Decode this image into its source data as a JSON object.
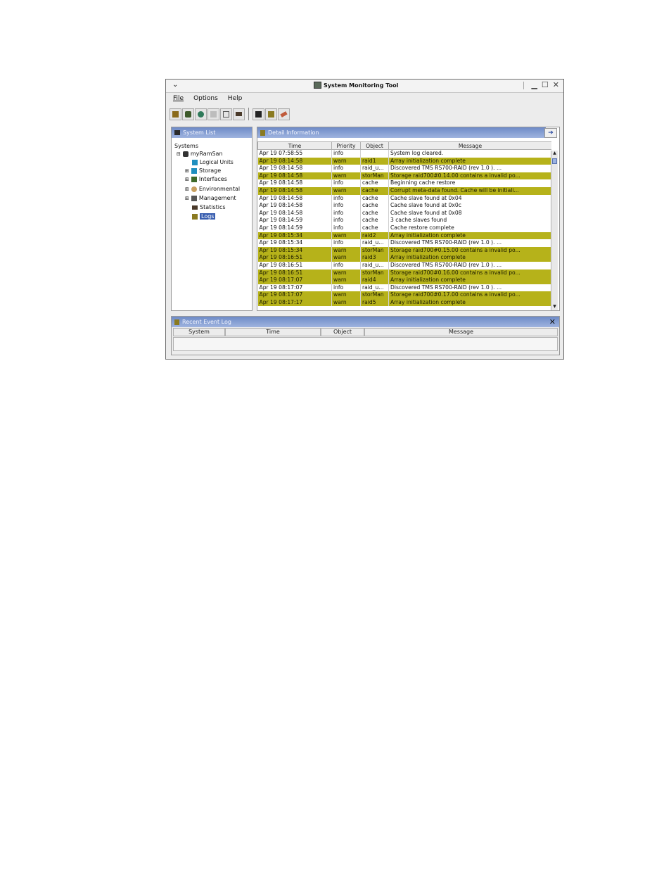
{
  "window": {
    "title": "System Monitoring Tool"
  },
  "menu": [
    "File",
    "Options",
    "Help"
  ],
  "toolbar_icons": [
    "open-system-icon",
    "add-system-icon",
    "globe-icon",
    "grid-icon",
    "collapse-icon",
    "display-icon",
    "save-icon",
    "notes-icon",
    "eraser-icon"
  ],
  "system_list": {
    "header": "System List",
    "root": "Systems",
    "system": "myRamSan",
    "items": [
      "Logical Units",
      "Storage",
      "Interfaces",
      "Environmental",
      "Management",
      "Statistics",
      "Logs"
    ]
  },
  "detail": {
    "header": "Detail Information",
    "columns": [
      "Time",
      "Priority",
      "Object",
      "Message"
    ],
    "rows": [
      {
        "time": "Apr 19 07:58:55",
        "priority": "info",
        "object": "",
        "message": "System log cleared."
      },
      {
        "time": "Apr 19 08:14:58",
        "priority": "warn",
        "object": "raid1",
        "message": "Array initialization complete"
      },
      {
        "time": "Apr 19 08:14:58",
        "priority": "info",
        "object": "raid_u...",
        "message": "Discovered TMS     RS700-RAID      (rev 1.0 ).  ..."
      },
      {
        "time": "Apr 19 08:14:58",
        "priority": "warn",
        "object": "storMan",
        "message": "Storage raid700#0.14.00 contains a invalid po..."
      },
      {
        "time": "Apr 19 08:14:58",
        "priority": "info",
        "object": "cache",
        "message": "Beginning cache restore"
      },
      {
        "time": "Apr 19 08:14:58",
        "priority": "warn",
        "object": "cache",
        "message": "Corrupt meta-data found.  Cache will be initiali..."
      },
      {
        "time": "Apr 19 08:14:58",
        "priority": "info",
        "object": "cache",
        "message": "Cache slave found at 0x04"
      },
      {
        "time": "Apr 19 08:14:58",
        "priority": "info",
        "object": "cache",
        "message": "Cache slave found at 0x0c"
      },
      {
        "time": "Apr 19 08:14:58",
        "priority": "info",
        "object": "cache",
        "message": "Cache slave found at 0x08"
      },
      {
        "time": "Apr 19 08:14:59",
        "priority": "info",
        "object": "cache",
        "message": "3 cache slaves found"
      },
      {
        "time": "Apr 19 08:14:59",
        "priority": "info",
        "object": "cache",
        "message": "Cache restore complete"
      },
      {
        "time": "Apr 19 08:15:34",
        "priority": "warn",
        "object": "raid2",
        "message": "Array initialization complete"
      },
      {
        "time": "Apr 19 08:15:34",
        "priority": "info",
        "object": "raid_u...",
        "message": "Discovered TMS     RS700-RAID      (rev 1.0 ).  ..."
      },
      {
        "time": "Apr 19 08:15:34",
        "priority": "warn",
        "object": "storMan",
        "message": "Storage raid700#0.15.00 contains a invalid po..."
      },
      {
        "time": "Apr 19 08:16:51",
        "priority": "warn",
        "object": "raid3",
        "message": "Array initialization complete"
      },
      {
        "time": "Apr 19 08:16:51",
        "priority": "info",
        "object": "raid_u...",
        "message": "Discovered TMS     RS700-RAID      (rev 1.0 ).  ..."
      },
      {
        "time": "Apr 19 08:16:51",
        "priority": "warn",
        "object": "storMan",
        "message": "Storage raid700#0.16.00 contains a invalid po..."
      },
      {
        "time": "Apr 19 08:17:07",
        "priority": "warn",
        "object": "raid4",
        "message": "Array initialization complete"
      },
      {
        "time": "Apr 19 08:17:07",
        "priority": "info",
        "object": "raid_u...",
        "message": "Discovered TMS     RS700-RAID      (rev 1.0 ).  ..."
      },
      {
        "time": "Apr 19 08:17:07",
        "priority": "warn",
        "object": "storMan",
        "message": "Storage raid700#0.17.00 contains a invalid po..."
      },
      {
        "time": "Apr 19 08:17:17",
        "priority": "warn",
        "object": "raid5",
        "message": "Array initialization complete"
      }
    ]
  },
  "recent": {
    "header": "Recent Event Log",
    "columns": [
      "System",
      "Time",
      "Object",
      "Message"
    ]
  },
  "colors": {
    "warn_row": "#b6b21a",
    "header_blue": "#6e8bc7",
    "selection": "#3a5fb0"
  }
}
